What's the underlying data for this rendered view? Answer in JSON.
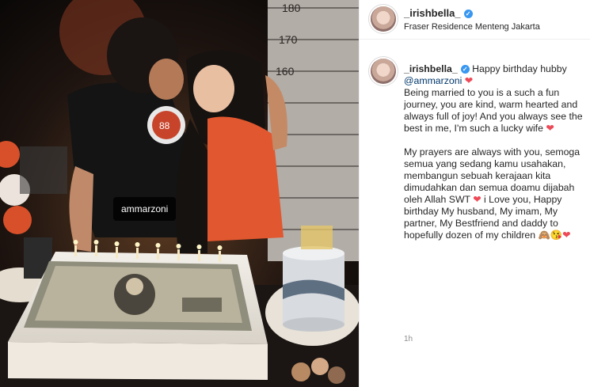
{
  "post": {
    "photo_tag": "ammarzoni",
    "ruler_marks": [
      "180",
      "170",
      "160"
    ],
    "author": {
      "username": "_irishbella_",
      "location": "Fraser Residence Menteng Jakarta"
    },
    "caption": {
      "username": "_irishbella_",
      "greeting": "Happy birthday hubby",
      "mention": "@ammarzoni",
      "para1": "Being married to you is a such a fun journey, you are kind, warm hearted and always full of joy! And you always see the best in me, I'm such a lucky wife",
      "para2a": "My prayers are always with you, semoga semua yang sedang kamu usahakan, membangun sebuah kerajaan kita dimudahkan dan semua doamu dijabah oleh Allah SWT",
      "para2b": "i Love you, Happy birthday My husband, My imam, My partner, My Bestfriend and daddy to hopefully dozen of my children",
      "emoji_end": "🙈😘"
    },
    "time_ago": "1h",
    "colors": {
      "link": "#00376b",
      "heart": "#ed4956",
      "verified": "#3897f0"
    }
  }
}
